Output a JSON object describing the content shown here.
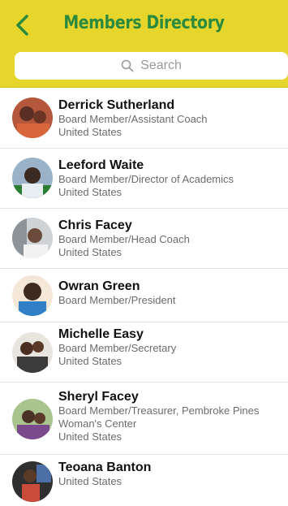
{
  "header": {
    "title": "Members Directory",
    "accent_color": "#e6d62c",
    "title_color": "#2b8a3e",
    "back_icon": "chevron-left-icon"
  },
  "search": {
    "placeholder": "Search",
    "icon": "search-icon"
  },
  "members": [
    {
      "name": "Derrick Sutherland",
      "role": "Board Member/Assistant Coach",
      "location": "United States"
    },
    {
      "name": "Leeford Waite",
      "role": "Board Member/Director of Academics",
      "location": "United States"
    },
    {
      "name": "Chris Facey",
      "role": "Board Member/Head Coach",
      "location": "United States"
    },
    {
      "name": "Owran Green",
      "role": "Board Member/President",
      "location": ""
    },
    {
      "name": "Michelle Easy",
      "role": "Board Member/Secretary",
      "location": "United States"
    },
    {
      "name": "Sheryl Facey",
      "role": "Board Member/Treasurer, Pembroke Pines Woman's Center",
      "location": "United States"
    },
    {
      "name": "Teoana Banton",
      "role": "",
      "location": "United States"
    }
  ]
}
